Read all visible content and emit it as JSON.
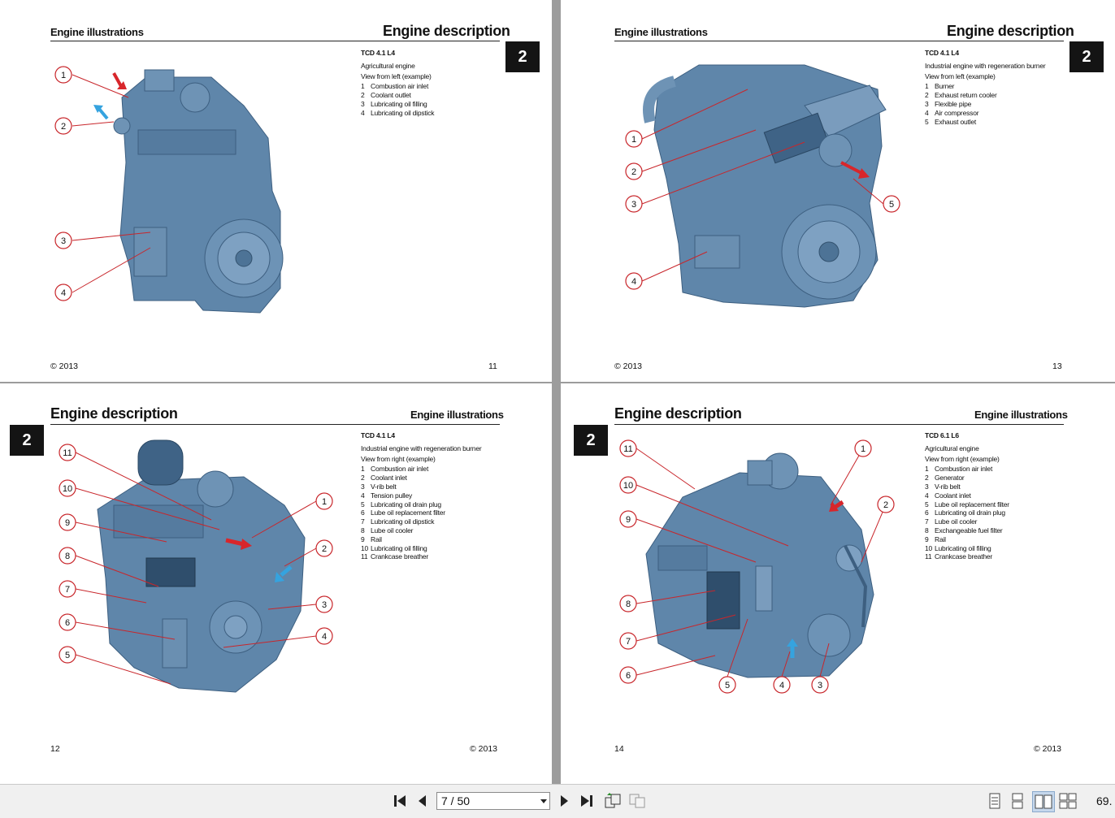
{
  "pages": {
    "p11": {
      "header_left": "Engine illustrations",
      "header_right": "Engine description",
      "tab": "2",
      "model": "TCD 4.1 L4",
      "subtitle1": "Agricultural engine",
      "subtitle2": "View from left (example)",
      "items": [
        {
          "n": "1",
          "label": "Combustion air inlet"
        },
        {
          "n": "2",
          "label": "Coolant outlet"
        },
        {
          "n": "3",
          "label": "Lubricating oil filling"
        },
        {
          "n": "4",
          "label": "Lubricating oil dipstick"
        }
      ],
      "callouts": [
        "1",
        "2",
        "3",
        "4"
      ],
      "footer_left": "© 2013",
      "footer_right": "11"
    },
    "p13": {
      "header_left": "Engine illustrations",
      "header_right": "Engine description",
      "tab": "2",
      "model": "TCD 4.1 L4",
      "subtitle1": "Industrial engine with regeneration burner",
      "subtitle2": "View from left (example)",
      "items": [
        {
          "n": "1",
          "label": "Burner"
        },
        {
          "n": "2",
          "label": "Exhaust return cooler"
        },
        {
          "n": "3",
          "label": "Flexible pipe"
        },
        {
          "n": "4",
          "label": "Air compressor"
        },
        {
          "n": "5",
          "label": "Exhaust outlet"
        }
      ],
      "callouts": [
        "1",
        "2",
        "3",
        "4",
        "5"
      ],
      "footer_left": "© 2013",
      "footer_right": "13"
    },
    "p12": {
      "header_left": "Engine description",
      "header_right": "Engine illustrations",
      "tab": "2",
      "model": "TCD 4.1 L4",
      "subtitle1": "Industrial engine with regeneration burner",
      "subtitle2": "View from right (example)",
      "items": [
        {
          "n": "1",
          "label": "Combustion air inlet"
        },
        {
          "n": "2",
          "label": "Coolant inlet"
        },
        {
          "n": "3",
          "label": "V-rib belt"
        },
        {
          "n": "4",
          "label": "Tension pulley"
        },
        {
          "n": "5",
          "label": "Lubricating oil drain plug"
        },
        {
          "n": "6",
          "label": "Lube oil replacement filter"
        },
        {
          "n": "7",
          "label": "Lubricating oil dipstick"
        },
        {
          "n": "8",
          "label": "Lube oil cooler"
        },
        {
          "n": "9",
          "label": "Rail"
        },
        {
          "n": "10",
          "label": "Lubricating oil filling"
        },
        {
          "n": "11",
          "label": "Crankcase breather"
        }
      ],
      "callouts": [
        "11",
        "10",
        "9",
        "8",
        "7",
        "6",
        "5",
        "1",
        "2",
        "3",
        "4"
      ],
      "footer_left": "12",
      "footer_right": "© 2013"
    },
    "p14": {
      "header_left": "Engine description",
      "header_right": "Engine illustrations",
      "tab": "2",
      "model": "TCD 6.1 L6",
      "subtitle1": "Agricultural engine",
      "subtitle2": "View from right (example)",
      "items": [
        {
          "n": "1",
          "label": "Combustion air inlet"
        },
        {
          "n": "2",
          "label": "Generator"
        },
        {
          "n": "3",
          "label": "V-rib belt"
        },
        {
          "n": "4",
          "label": "Coolant inlet"
        },
        {
          "n": "5",
          "label": "Lube oil replacement filter"
        },
        {
          "n": "6",
          "label": "Lubricating oil drain plug"
        },
        {
          "n": "7",
          "label": "Lube oil cooler"
        },
        {
          "n": "8",
          "label": "Exchangeable fuel filter"
        },
        {
          "n": "9",
          "label": "Rail"
        },
        {
          "n": "10",
          "label": "Lubricating oil filling"
        },
        {
          "n": "11",
          "label": "Crankcase breather"
        }
      ],
      "callouts": [
        "11",
        "10",
        "9",
        "8",
        "7",
        "6",
        "1",
        "2",
        "5",
        "4",
        "3"
      ],
      "footer_left": "14",
      "footer_right": "© 2013"
    }
  },
  "toolbar": {
    "page_indicator": "7 / 50",
    "zoom": "69.",
    "icons": [
      "first-page-icon",
      "prev-page-icon",
      "next-page-icon",
      "last-page-icon",
      "back-view-icon",
      "forward-view-icon",
      "single-page-icon",
      "continuous-page-icon",
      "facing-pages-icon",
      "continuous-facing-icon"
    ]
  },
  "colors": {
    "engine": "#5f86aa",
    "callout": "#c8262b",
    "arrow_red": "#d8262b",
    "arrow_blue": "#35a3df"
  }
}
